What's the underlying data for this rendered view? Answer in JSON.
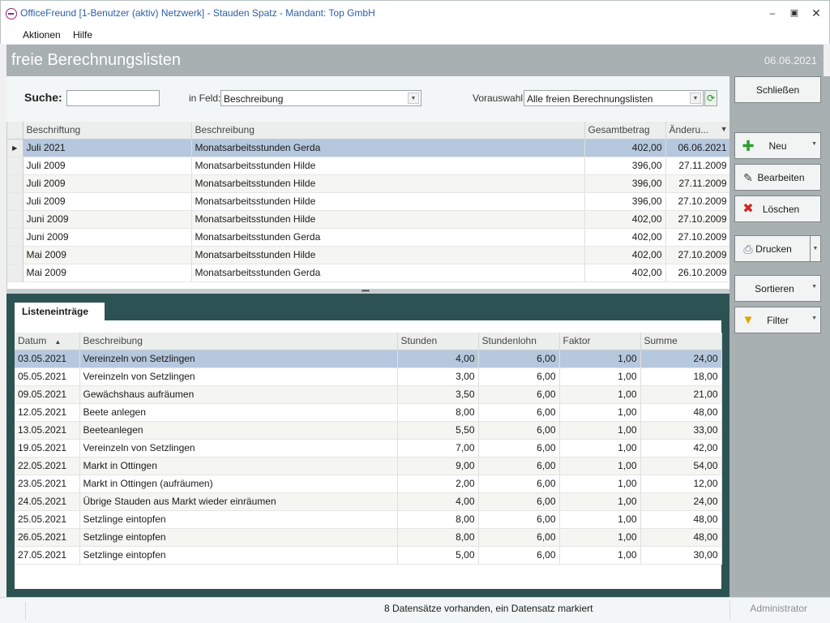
{
  "window": {
    "title": "OfficeFreund [1-Benutzer (aktiv) Netzwerk]  -  Stauden Spatz  -  Mandant: Top GmbH",
    "controls": [
      "minimize-icon",
      "maximize-icon",
      "close-icon"
    ]
  },
  "menu": {
    "items": [
      "Aktionen",
      "Hilfe"
    ]
  },
  "header": {
    "title": "freie Berechnungslisten",
    "date": "06.06.2021"
  },
  "search": {
    "label": "Suche:",
    "value": "",
    "field_label": "in Feld:",
    "field_value": "Beschreibung",
    "preselect_label": "Vorauswahl:",
    "preselect_value": "Alle freien Berechnungslisten"
  },
  "lists": {
    "columns": [
      "Beschriftung",
      "Beschreibung",
      "Gesamtbetrag",
      "Änderu..."
    ],
    "rows": [
      [
        "Juli 2021",
        "Monatsarbeitsstunden Gerda",
        "402,00",
        "06.06.2021"
      ],
      [
        "Juli 2009",
        "Monatsarbeitsstunden Hilde",
        "396,00",
        "27.11.2009"
      ],
      [
        "Juli 2009",
        "Monatsarbeitsstunden Hilde",
        "396,00",
        "27.11.2009"
      ],
      [
        "Juli 2009",
        "Monatsarbeitsstunden Hilde",
        "396,00",
        "27.10.2009"
      ],
      [
        "Juni 2009",
        "Monatsarbeitsstunden Hilde",
        "402,00",
        "27.10.2009"
      ],
      [
        "Juni 2009",
        "Monatsarbeitsstunden Gerda",
        "402,00",
        "27.10.2009"
      ],
      [
        "Mai 2009",
        "Monatsarbeitsstunden Hilde",
        "402,00",
        "27.10.2009"
      ],
      [
        "Mai 2009",
        "Monatsarbeitsstunden Gerda",
        "402,00",
        "26.10.2009"
      ]
    ],
    "selected_index": 0
  },
  "entries": {
    "tab_label": "Listeneinträge",
    "columns": [
      "Datum",
      "Beschreibung",
      "Stunden",
      "Stundenlohn",
      "Faktor",
      "Summe"
    ],
    "rows": [
      [
        "03.05.2021",
        "Vereinzeln von Setzlingen",
        "4,00",
        "6,00",
        "1,00",
        "24,00"
      ],
      [
        "05.05.2021",
        "Vereinzeln von Setzlingen",
        "3,00",
        "6,00",
        "1,00",
        "18,00"
      ],
      [
        "09.05.2021",
        "Gewächshaus aufräumen",
        "3,50",
        "6,00",
        "1,00",
        "21,00"
      ],
      [
        "12.05.2021",
        "Beete anlegen",
        "8,00",
        "6,00",
        "1,00",
        "48,00"
      ],
      [
        "13.05.2021",
        "Beeteanlegen",
        "5,50",
        "6,00",
        "1,00",
        "33,00"
      ],
      [
        "19.05.2021",
        "Vereinzeln von Setzlingen",
        "7,00",
        "6,00",
        "1,00",
        "42,00"
      ],
      [
        "22.05.2021",
        "Markt in Ottingen",
        "9,00",
        "6,00",
        "1,00",
        "54,00"
      ],
      [
        "23.05.2021",
        "Markt in Ottingen (aufräumen)",
        "2,00",
        "6,00",
        "1,00",
        "12,00"
      ],
      [
        "24.05.2021",
        "Übrige Stauden aus Markt wieder einräumen",
        "4,00",
        "6,00",
        "1,00",
        "24,00"
      ],
      [
        "25.05.2021",
        "Setzlinge eintopfen",
        "8,00",
        "6,00",
        "1,00",
        "48,00"
      ],
      [
        "26.05.2021",
        "Setzlinge eintopfen",
        "8,00",
        "6,00",
        "1,00",
        "48,00"
      ],
      [
        "27.05.2021",
        "Setzlinge eintopfen",
        "5,00",
        "6,00",
        "1,00",
        "30,00"
      ]
    ],
    "selected_index": 0
  },
  "sidebar": {
    "close": "Schließen",
    "new": "Neu",
    "edit": "Bearbeiten",
    "delete": "Löschen",
    "print": "Drucken",
    "sort": "Sortieren",
    "filter": "Filter"
  },
  "status": {
    "text": "8 Datensätze vorhanden, ein Datensatz markiert",
    "user": "Administrator"
  },
  "colors": {
    "header_bg": "#a9b0b1",
    "detail_bg": "#2d5254",
    "selection": "#b6c8de",
    "title_text": "#2b5ea8"
  }
}
